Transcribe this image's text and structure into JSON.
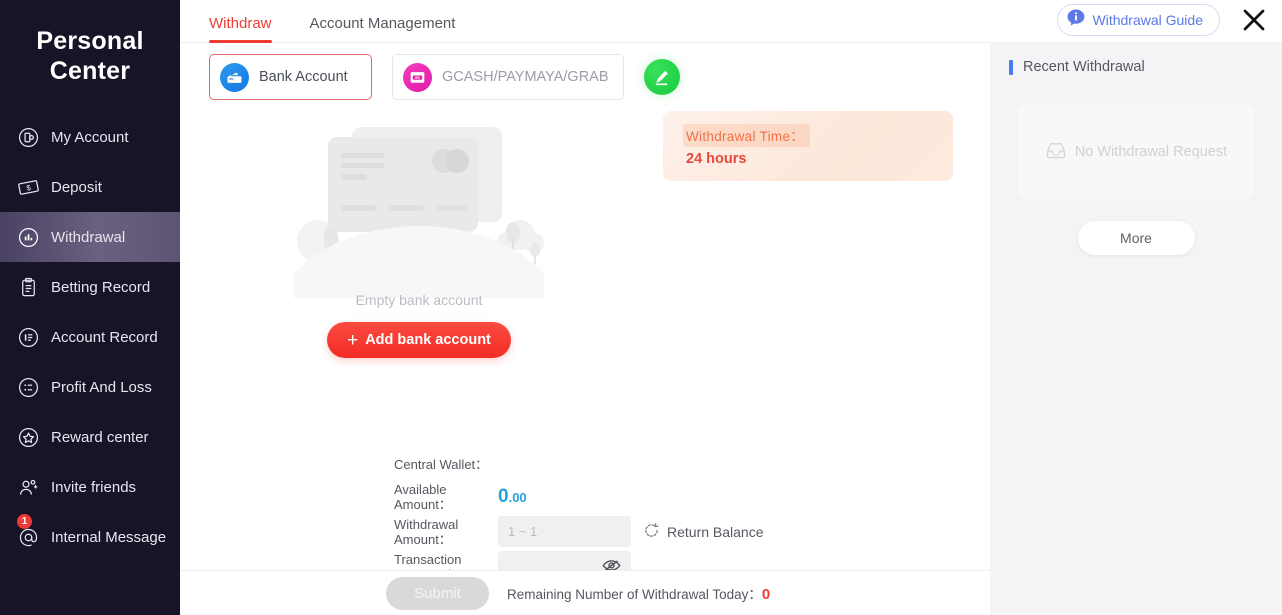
{
  "sidebar": {
    "brand_line1": "Personal",
    "brand_line2": "Center",
    "items": [
      {
        "label": "My Account",
        "icon": "account-circle-icon",
        "active": false,
        "badge": ""
      },
      {
        "label": "Deposit",
        "icon": "banknote-icon",
        "active": false,
        "badge": ""
      },
      {
        "label": "Withdrawal",
        "icon": "chart-circle-icon",
        "active": true,
        "badge": ""
      },
      {
        "label": "Betting Record",
        "icon": "clipboard-icon",
        "active": false,
        "badge": ""
      },
      {
        "label": "Account Record",
        "icon": "document-circle-icon",
        "active": false,
        "badge": ""
      },
      {
        "label": "Profit And Loss",
        "icon": "list-circle-icon",
        "active": false,
        "badge": ""
      },
      {
        "label": "Reward center",
        "icon": "star-circle-icon",
        "active": false,
        "badge": ""
      },
      {
        "label": "Invite friends",
        "icon": "user-add-icon",
        "active": false,
        "badge": ""
      },
      {
        "label": "Internal Message",
        "icon": "at-circle-icon",
        "active": false,
        "badge": "1"
      }
    ]
  },
  "header": {
    "tabs": [
      {
        "label": "Withdraw",
        "active": true
      },
      {
        "label": "Account Management",
        "active": false
      }
    ],
    "guide_label": "Withdrawal Guide",
    "guide_icon": "info-bubble-icon",
    "close_icon": "close-icon"
  },
  "methods": [
    {
      "label": "Bank Account",
      "icon": "bank-card-icon",
      "selected": true
    },
    {
      "label": "GCASH/PAYMAYA/GRAB",
      "icon": "ewallet-icon",
      "selected": false
    }
  ],
  "edit_button": {
    "icon": "pencil-icon"
  },
  "notice": {
    "title": "Withdrawal Time：",
    "value": "24 hours"
  },
  "empty_state": {
    "text": "Empty bank account",
    "add_label": "Add bank account",
    "add_plus": "+"
  },
  "form": {
    "wallet_label": "Central Wallet：",
    "available_label": "Available Amount：",
    "available_int": "0",
    "available_dec": ".00",
    "withdrawal_label": "Withdrawal Amount：",
    "withdrawal_value": "",
    "withdrawal_placeholder": "1 ~ 1",
    "password_label": "Transaction Password：",
    "password_value": "",
    "password_placeholder": "",
    "return_balance_label": "Return Balance",
    "return_balance_icon": "refresh-icon",
    "eye_icon": "eye-off-icon"
  },
  "footer": {
    "submit_label": "Submit",
    "remaining_label": "Remaining Number of Withdrawal Today：",
    "remaining_count": "0"
  },
  "right_panel": {
    "title": "Recent Withdrawal",
    "empty_text": "No Withdrawal Request",
    "empty_icon": "inbox-icon",
    "more_label": "More"
  },
  "colors": {
    "sidebar_bg": "#171428",
    "accent_red": "#eb3d34",
    "guide_blue": "#5b79e8",
    "amount_blue": "#23a3dd",
    "green_fab": "#15cc3d",
    "panel_bg": "#f4f4f6"
  }
}
